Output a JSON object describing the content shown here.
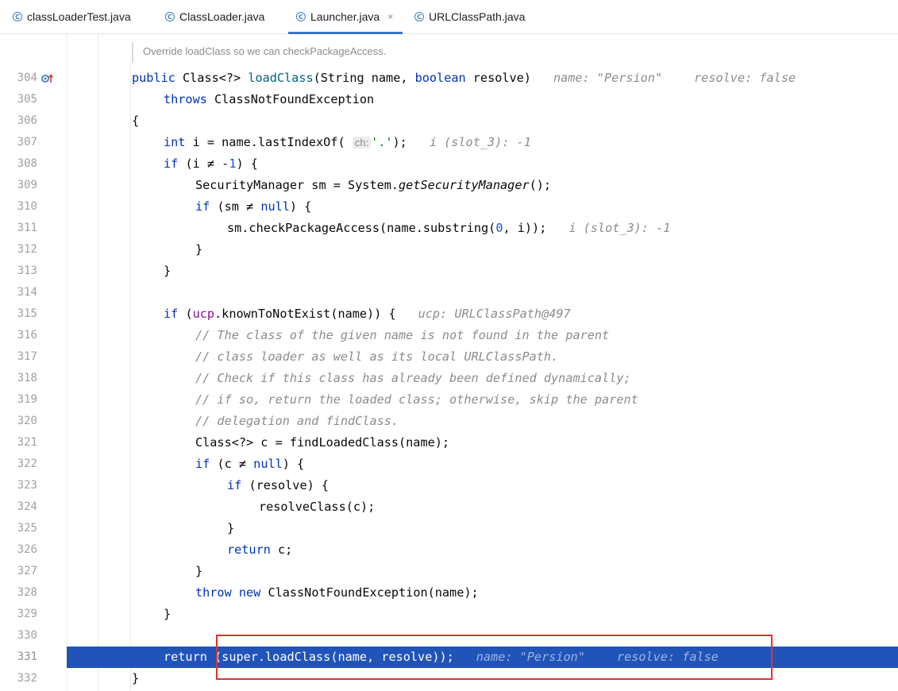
{
  "tabs": [
    {
      "label": "classLoaderTest.java",
      "active": false
    },
    {
      "label": "ClassLoader.java",
      "active": false
    },
    {
      "label": "Launcher.java",
      "active": true,
      "close": "×"
    },
    {
      "label": "URLClassPath.java",
      "active": false
    }
  ],
  "doc_hint": "Override loadClass so we can checkPackageAccess.",
  "colors": {
    "accent": "#3c73c8",
    "execution_line": "#2154b9",
    "highlight_box": "#e5322d"
  },
  "icons": {
    "tab_icon": "class-c-icon",
    "gutter_marker": "override-method-up-arrow-icon"
  },
  "lines": [
    {
      "n": "304",
      "text": "public Class<?> loadClass(String name, boolean resolve)",
      "hints": [
        "name: \"Persion\"",
        "resolve: false"
      ]
    },
    {
      "n": "305",
      "text": "throws ClassNotFoundException"
    },
    {
      "n": "306",
      "text": "{"
    },
    {
      "n": "307",
      "text": "int i = name.lastIndexOf( ch: '.');",
      "param_hint": "ch:",
      "hints": [
        "i (slot_3): -1"
      ]
    },
    {
      "n": "308",
      "text": "if (i ≠ -1) {"
    },
    {
      "n": "309",
      "text": "SecurityManager sm = System.getSecurityManager();"
    },
    {
      "n": "310",
      "text": "if (sm ≠ null) {"
    },
    {
      "n": "311",
      "text": "sm.checkPackageAccess(name.substring(0, i));",
      "hints": [
        "i (slot_3): -1"
      ]
    },
    {
      "n": "312",
      "text": "}"
    },
    {
      "n": "313",
      "text": "}"
    },
    {
      "n": "314",
      "text": ""
    },
    {
      "n": "315",
      "text": "if (ucp.knownToNotExist(name)) {",
      "hints": [
        "ucp: URLClassPath@497"
      ]
    },
    {
      "n": "316",
      "text": "// The class of the given name is not found in the parent"
    },
    {
      "n": "317",
      "text": "// class loader as well as its local URLClassPath."
    },
    {
      "n": "318",
      "text": "// Check if this class has already been defined dynamically;"
    },
    {
      "n": "319",
      "text": "// if so, return the loaded class; otherwise, skip the parent"
    },
    {
      "n": "320",
      "text": "// delegation and findClass."
    },
    {
      "n": "321",
      "text": "Class<?> c = findLoadedClass(name);"
    },
    {
      "n": "322",
      "text": "if (c ≠ null) {"
    },
    {
      "n": "323",
      "text": "if (resolve) {"
    },
    {
      "n": "324",
      "text": "resolveClass(c);"
    },
    {
      "n": "325",
      "text": "}"
    },
    {
      "n": "326",
      "text": "return c;"
    },
    {
      "n": "327",
      "text": "}"
    },
    {
      "n": "328",
      "text": "throw new ClassNotFoundException(name);"
    },
    {
      "n": "329",
      "text": "}"
    },
    {
      "n": "330",
      "text": ""
    },
    {
      "n": "331",
      "text": "return (super.loadClass(name, resolve));",
      "hints": [
        "name: \"Persion\"",
        "resolve: false"
      ],
      "current_execution": true
    },
    {
      "n": "332",
      "text": "}"
    }
  ]
}
